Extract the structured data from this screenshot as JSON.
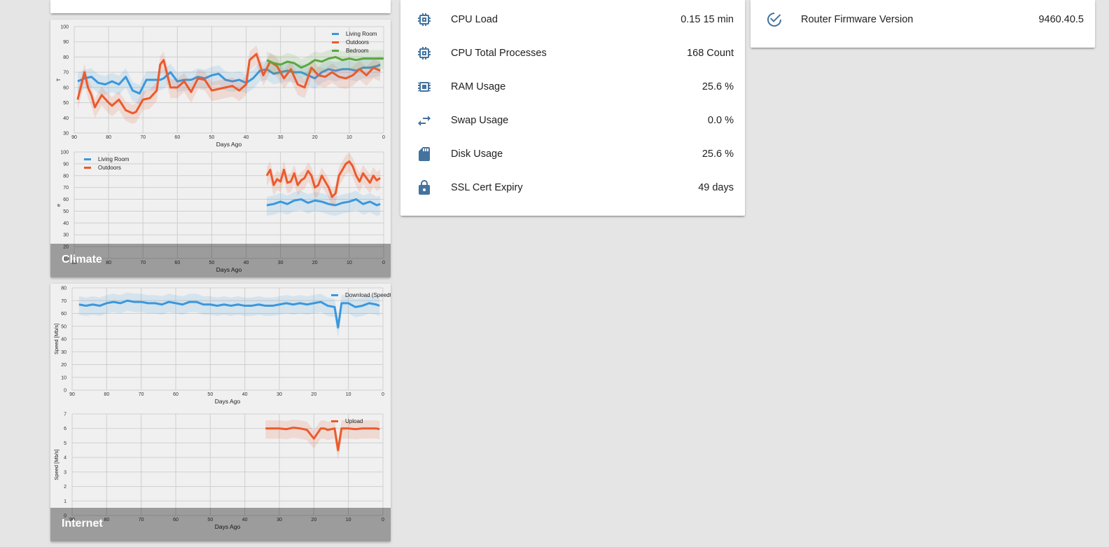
{
  "colors": {
    "blue": "#3b97dc",
    "orange": "#eb5a2c",
    "green": "#5ba743",
    "icon": "#44739e",
    "grid": "#cfcfcf",
    "bg": "#e5e5e5"
  },
  "system": {
    "rows": [
      {
        "icon": "cpu-icon",
        "label": "CPU Load",
        "value": "0.15 15 min"
      },
      {
        "icon": "cpu-icon",
        "label": "CPU Total Processes",
        "value": "168 Count"
      },
      {
        "icon": "memory-icon",
        "label": "RAM Usage",
        "value": "25.6 %"
      },
      {
        "icon": "swap-icon",
        "label": "Swap Usage",
        "value": "0.0 %"
      },
      {
        "icon": "sd-card-icon",
        "label": "Disk Usage",
        "value": "25.6 %"
      },
      {
        "icon": "lock-icon",
        "label": "SSL Cert Expiry",
        "value": "49 days"
      }
    ]
  },
  "router": {
    "icon": "check-circle-icon",
    "label": "Router Firmware Version",
    "value": "9460.40.5"
  },
  "climate": {
    "caption": "Climate"
  },
  "internet": {
    "caption": "Internet"
  },
  "chart_data": [
    {
      "type": "line",
      "xlabel": "Days Ago",
      "ylabel": "T",
      "xlim": [
        90,
        0
      ],
      "ylim": [
        30,
        100
      ],
      "xticks": [
        90,
        80,
        70,
        60,
        50,
        40,
        30,
        20,
        10,
        0
      ],
      "yticks": [
        30,
        40,
        50,
        60,
        70,
        80,
        90,
        100
      ],
      "legend": "top-right",
      "series": [
        {
          "name": "Living Room",
          "x": [
            89,
            87,
            85,
            83,
            81,
            79,
            77,
            75,
            73,
            71,
            69,
            67,
            65,
            64,
            62,
            60,
            58,
            56,
            54,
            52,
            50,
            48,
            46,
            44,
            42,
            40,
            38,
            36,
            34,
            32,
            30,
            28,
            26,
            24,
            22,
            20,
            18,
            16,
            14,
            12,
            10,
            8,
            6,
            4,
            2,
            1
          ],
          "y": [
            64,
            66,
            67,
            63,
            62,
            64,
            62,
            67,
            58,
            56,
            65,
            65,
            65,
            66,
            70,
            64,
            65,
            65,
            67,
            66,
            68,
            69,
            65,
            64,
            65,
            63,
            66,
            71,
            72,
            69,
            70,
            71,
            70,
            70,
            68,
            66,
            70,
            72,
            71,
            72,
            72,
            71,
            73,
            73,
            74,
            75
          ]
        },
        {
          "name": "Outdoors",
          "x": [
            89,
            87,
            86,
            85,
            84,
            82,
            80,
            79,
            77,
            75,
            73,
            72,
            70,
            68,
            66,
            65,
            64,
            62,
            60,
            58,
            56,
            54,
            52,
            50,
            48,
            46,
            44,
            42,
            40,
            39,
            37,
            35,
            33,
            31,
            29,
            27,
            25,
            23,
            21,
            19,
            17,
            15,
            13,
            11,
            9,
            7,
            5,
            3,
            1
          ],
          "y": [
            52,
            70,
            60,
            55,
            47,
            55,
            50,
            48,
            52,
            45,
            43,
            44,
            52,
            53,
            58,
            75,
            78,
            60,
            60,
            64,
            57,
            66,
            65,
            58,
            59,
            60,
            61,
            58,
            62,
            78,
            82,
            68,
            77,
            74,
            66,
            72,
            62,
            60,
            73,
            68,
            67,
            70,
            67,
            66,
            68,
            72,
            68,
            73,
            71
          ]
        },
        {
          "name": "Bedroom",
          "x": [
            34,
            32,
            30,
            28,
            26,
            24,
            22,
            20,
            18,
            16,
            14,
            12,
            10,
            8,
            6,
            4,
            2,
            0
          ],
          "y": [
            78,
            76,
            75,
            77,
            76,
            73,
            75,
            78,
            77,
            79,
            80,
            78,
            79,
            78,
            79,
            79,
            79,
            79
          ]
        }
      ]
    },
    {
      "type": "line",
      "xlabel": "Days Ago",
      "ylabel": "e",
      "xlim": [
        90,
        0
      ],
      "ylim": [
        10,
        100
      ],
      "xticks": [
        90,
        80,
        70,
        60,
        50,
        40,
        30,
        20,
        10,
        0
      ],
      "yticks": [
        10,
        20,
        30,
        40,
        50,
        60,
        70,
        80,
        90,
        100
      ],
      "legend": "top-left",
      "series": [
        {
          "name": "Living Room",
          "x": [
            34,
            32,
            30,
            28,
            26,
            24,
            22,
            20,
            18,
            16,
            14,
            12,
            10,
            8,
            6,
            4,
            2,
            1
          ],
          "y": [
            55,
            56,
            58,
            56,
            59,
            60,
            57,
            59,
            58,
            56,
            55,
            57,
            58,
            60,
            56,
            58,
            55,
            56
          ]
        },
        {
          "name": "Outdoors",
          "x": [
            34,
            33,
            32,
            31,
            30,
            29,
            28,
            27,
            26,
            25,
            24,
            23,
            22,
            21,
            20,
            19,
            18,
            17,
            16,
            15,
            14,
            13,
            12,
            11,
            10,
            9,
            8,
            7,
            6,
            5,
            4,
            3,
            2,
            1
          ],
          "y": [
            80,
            85,
            72,
            77,
            75,
            85,
            74,
            75,
            82,
            72,
            76,
            78,
            84,
            80,
            70,
            72,
            80,
            75,
            70,
            62,
            65,
            80,
            85,
            90,
            92,
            88,
            80,
            75,
            82,
            78,
            74,
            80,
            76,
            78
          ]
        }
      ]
    },
    {
      "type": "line",
      "xlabel": "Days Ago",
      "ylabel": "Speed [Mb/s]",
      "xlim": [
        90,
        0
      ],
      "ylim": [
        0,
        80
      ],
      "xticks": [
        90,
        80,
        70,
        60,
        50,
        40,
        30,
        20,
        10,
        0
      ],
      "yticks": [
        0,
        10,
        20,
        30,
        40,
        50,
        60,
        70,
        80
      ],
      "legend": "top-right",
      "series": [
        {
          "name": "Download (Speedtest)",
          "x": [
            88,
            86,
            84,
            82,
            80,
            78,
            76,
            74,
            72,
            70,
            68,
            66,
            64,
            62,
            60,
            58,
            56,
            54,
            52,
            50,
            48,
            46,
            44,
            42,
            40,
            38,
            36,
            34,
            32,
            30,
            28,
            26,
            24,
            22,
            20,
            18,
            16,
            14,
            13,
            12,
            10,
            8,
            6,
            4,
            2,
            1
          ],
          "y": [
            67,
            66,
            67,
            66,
            68,
            69,
            68,
            70,
            69,
            69,
            68,
            68,
            67,
            69,
            68,
            67,
            69,
            69,
            67,
            67,
            66,
            67,
            66,
            67,
            66,
            66,
            67,
            66,
            66,
            67,
            68,
            67,
            68,
            67,
            68,
            69,
            66,
            65,
            49,
            68,
            68,
            65,
            66,
            68,
            67,
            66
          ]
        }
      ]
    },
    {
      "type": "line",
      "xlabel": "Days Ago",
      "ylabel": "Speed [Mb/s]",
      "xlim": [
        90,
        0
      ],
      "ylim": [
        0,
        7
      ],
      "xticks": [
        90,
        80,
        70,
        60,
        50,
        40,
        30,
        20,
        10,
        0
      ],
      "yticks": [
        0,
        1,
        2,
        3,
        4,
        5,
        6,
        7
      ],
      "legend": "top-right",
      "series": [
        {
          "name": "Upload",
          "x": [
            34,
            32,
            30,
            28,
            26,
            24,
            22,
            20,
            18,
            17,
            16,
            14,
            13,
            12,
            10,
            8,
            6,
            4,
            2,
            1
          ],
          "y": [
            6.0,
            6.0,
            6.0,
            5.95,
            6.05,
            6.0,
            5.9,
            5.3,
            6.0,
            6.0,
            5.9,
            6.0,
            4.5,
            6.0,
            6.0,
            5.95,
            6.0,
            6.0,
            6.0,
            5.95
          ]
        }
      ]
    }
  ]
}
